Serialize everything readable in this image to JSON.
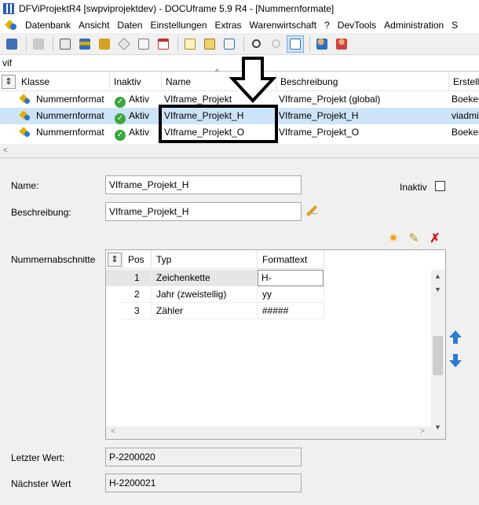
{
  "window": {
    "title": "DFViProjektR4 [swpviprojektdev) - DOCUframe 5.9 R4 - [Nummernformate]"
  },
  "menu": {
    "items": [
      "Datenbank",
      "Ansicht",
      "Daten",
      "Einstellungen",
      "Extras",
      "Warenwirtschaft",
      "?",
      "DevTools",
      "Administration",
      "S"
    ]
  },
  "toolbar": {
    "icons": [
      "save-icon",
      "print-icon",
      "card-icon",
      "list-icon",
      "folder-icon",
      "tag-icon",
      "document-icon",
      "calendar-icon",
      "new-document-icon",
      "envelope-icon",
      "task-icon",
      "search-icon",
      "search-disabled-icon",
      "form-view-icon",
      "users-icon",
      "user-group-icon"
    ],
    "active_icon": "form-view-icon"
  },
  "search": {
    "value": "vif"
  },
  "top_grid": {
    "columns": [
      "Klasse",
      "Inaktiv",
      "Name",
      "Beschreibung",
      "Erstell"
    ],
    "rows": [
      {
        "klasse": "Nummernformat",
        "inaktiv": "Aktiv",
        "name": "VIframe_Projekt",
        "beschreibung": "VIframe_Projekt (global)",
        "erstell": "Boeker"
      },
      {
        "klasse": "Nummernformat",
        "inaktiv": "Aktiv",
        "name": "VIframe_Projekt_H",
        "beschreibung": "VIframe_Projekt_H",
        "erstell": "viadmi"
      },
      {
        "klasse": "Nummernformat",
        "inaktiv": "Aktiv",
        "name": "VIframe_Projekt_O",
        "beschreibung": "VIframe_Projekt_O",
        "erstell": "Boeker"
      }
    ],
    "selected_row": 1
  },
  "form": {
    "name_label": "Name:",
    "name_value": "VIframe_Projekt_H",
    "inaktiv_label": "Inaktiv",
    "beschreibung_label": "Beschreibung:",
    "beschreibung_value": "VIframe_Projekt_H",
    "nummernabschnitte_label": "Nummernabschnitte",
    "letzter_wert_label": "Letzter Wert:",
    "letzter_wert_value": "P-2200020",
    "naechster_wert_label": "Nächster Wert",
    "naechster_wert_value": "H-2200021"
  },
  "sections_grid": {
    "columns": [
      "Pos",
      "Typ",
      "Formattext"
    ],
    "rows": [
      {
        "pos": "1",
        "typ": "Zeichenkette",
        "formattext": "H-"
      },
      {
        "pos": "2",
        "typ": "Jahr (zweistellig)",
        "formattext": "yy"
      },
      {
        "pos": "3",
        "typ": "Zähler",
        "formattext": "#####"
      }
    ]
  },
  "colors": {
    "selection": "#cce4f7",
    "accent_blue": "#2b7bd0",
    "check_green": "#3aa83a"
  }
}
